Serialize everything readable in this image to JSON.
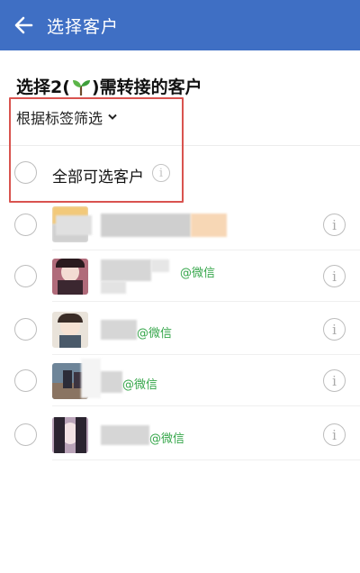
{
  "header": {
    "title": "选择客户",
    "background": "#3F6FC4"
  },
  "heading": {
    "prefix": "选择2(",
    "suffix": ")需转接的客户",
    "emoji": "sprout-icon"
  },
  "filter": {
    "label": "根据标签筛选"
  },
  "select_all": {
    "label": "全部可选客户"
  },
  "customers": [
    {
      "tag": ""
    },
    {
      "tag": "@微信"
    },
    {
      "tag": "@微信"
    },
    {
      "tag": "@微信"
    },
    {
      "tag": "@微信"
    }
  ],
  "colors": {
    "accent": "#3F6FC4",
    "highlight_box": "#D9534F",
    "wechat_tag": "#35A64A"
  },
  "info_glyph": "i"
}
